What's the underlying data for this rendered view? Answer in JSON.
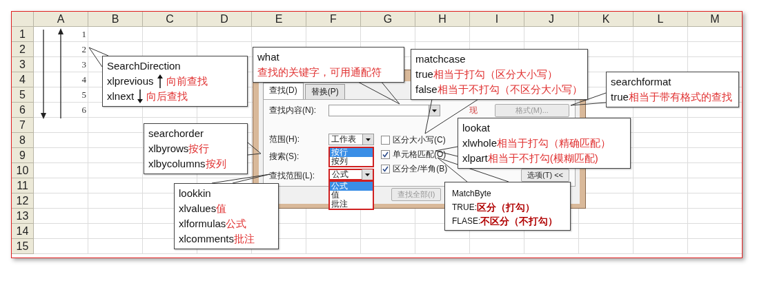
{
  "sheet": {
    "columns": [
      "A",
      "B",
      "C",
      "D",
      "E",
      "F",
      "G",
      "H",
      "I",
      "J",
      "K",
      "L",
      "M"
    ],
    "rows": [
      "1",
      "2",
      "3",
      "4",
      "5",
      "6",
      "7",
      "8",
      "9",
      "10",
      "11",
      "12",
      "13",
      "14",
      "15"
    ],
    "column_a_values": [
      "1",
      "2",
      "3",
      "4",
      "5",
      "6"
    ]
  },
  "dialog": {
    "tabs": [
      {
        "label": "查找(D)",
        "selected": true
      },
      {
        "label": "替换(P)",
        "selected": false
      }
    ],
    "find_what": {
      "label": "查找内容(N):"
    },
    "partial_text": "现",
    "format_button": {
      "label": "格式(M)...",
      "disabled": true
    },
    "within": {
      "label": "范围(H):",
      "value": "工作表"
    },
    "search": {
      "label": "搜索(S):",
      "options": [
        {
          "label": "按行",
          "selected": true
        },
        {
          "label": "按列",
          "selected": false
        }
      ]
    },
    "look_in": {
      "label": "查找范围(L):",
      "value": "公式",
      "options": [
        {
          "label": "公式",
          "selected": true
        },
        {
          "label": "值",
          "selected": false
        },
        {
          "label": "批注",
          "selected": false
        }
      ]
    },
    "checkboxes": [
      {
        "label": "区分大小写(C)",
        "checked": false
      },
      {
        "label": "单元格匹配(O)",
        "checked": true
      },
      {
        "label": "区分全/半角(B)",
        "checked": true
      }
    ],
    "options_button": "选项(T) <<",
    "find_all_button": {
      "label": "查找全部(I)",
      "disabled": true
    }
  },
  "callouts": [
    {
      "kind": "plain",
      "title": "SearchDirection",
      "lines": [
        {
          "kind": "arrow-up",
          "code": "xlprevious",
          "note": "向前查找"
        },
        {
          "kind": "arrow-down",
          "code": "xlnext",
          "note": "向后查找"
        }
      ]
    },
    {
      "kind": "plain",
      "title": "what",
      "lines": [
        {
          "note": "查找的关键字，可用通配符"
        }
      ]
    },
    {
      "kind": "plain",
      "title": "matchcase",
      "lines": [
        {
          "code": "true",
          "note": "相当于打勾（区分大小写）"
        },
        {
          "code": "false",
          "note": "相当于不打勾（不区分大小写）"
        }
      ]
    },
    {
      "kind": "plain",
      "title": "searchformat",
      "lines": [
        {
          "code": "true",
          "note": "相当于带有格式的查找"
        }
      ]
    },
    {
      "kind": "plain",
      "title": "searchorder",
      "lines": [
        {
          "code": "xlbyrows",
          "note": "按行"
        },
        {
          "code": "xlbycolumns",
          "note": "按列"
        }
      ]
    },
    {
      "kind": "plain",
      "title": "lookat",
      "lines": [
        {
          "code": "xlwhole ",
          "note": "相当于打勾（精确匹配）"
        },
        {
          "code": "xlpart",
          "note": "相当于不打勾(模糊匹配)"
        }
      ]
    },
    {
      "kind": "plain",
      "title": "lookkin",
      "lines": [
        {
          "code": "xlvalues",
          "note": "值"
        },
        {
          "code": "xlformulas",
          "note": "公式"
        },
        {
          "code": "xlcomments",
          "note": "批注"
        }
      ]
    },
    {
      "kind": "bold",
      "title": "MatchByte",
      "lines": [
        {
          "code": "TRUE:",
          "note": "区分（打勾）"
        },
        {
          "code": "FLASE:",
          "note": "不区分（不打勾）"
        }
      ]
    }
  ]
}
